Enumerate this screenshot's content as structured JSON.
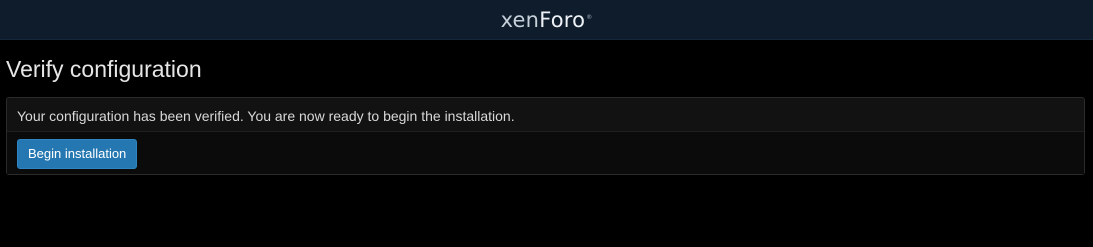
{
  "header": {
    "logo_prefix": "xen",
    "logo_suffix": "Foro",
    "logo_mark": "®"
  },
  "page": {
    "title": "Verify configuration"
  },
  "block": {
    "message": "Your configuration has been verified. You are now ready to begin the installation.",
    "button_label": "Begin installation"
  },
  "colors": {
    "header_bg": "#0e1c2b",
    "page_bg": "#000000",
    "button_bg": "#2577b1"
  }
}
